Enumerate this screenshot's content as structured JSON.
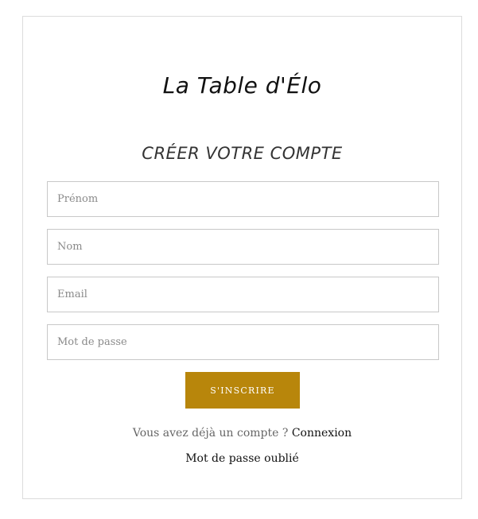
{
  "brand": {
    "logo_text": "La Table d'Élo"
  },
  "page": {
    "title": "CRÉER VOTRE COMPTE"
  },
  "form": {
    "firstname_placeholder": "Prénom",
    "lastname_placeholder": "Nom",
    "email_placeholder": "Email",
    "password_placeholder": "Mot de passe",
    "submit_label": "S'INSCRIRE"
  },
  "footer": {
    "have_account_text": "Vous avez déjà un compte ?",
    "login_link": "Connexion",
    "forgot_password_link": "Mot de passe oublié"
  },
  "colors": {
    "accent": "#b8860b",
    "border": "#c8c8c8",
    "text": "#111111",
    "muted": "#666666"
  }
}
